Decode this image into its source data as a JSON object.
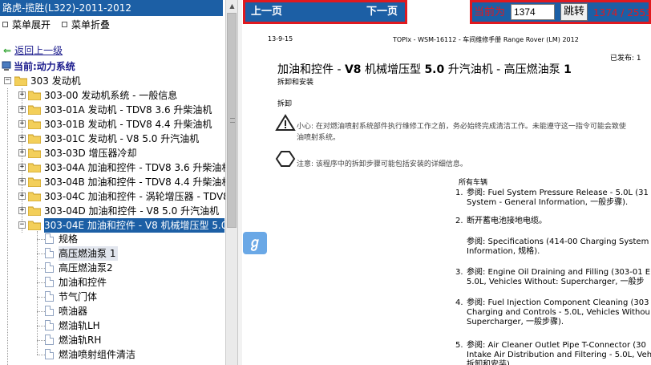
{
  "left_panel": {
    "title": "路虎-揽胜(L322)-2011-2012",
    "menu_expand": "菜单展开",
    "menu_collapse": "菜单折叠",
    "back_link": "返回上一级",
    "current": "当前:动力系统",
    "root_node": "303 发动机",
    "tree": [
      "303-00 发动机系统 - 一般信息",
      "303-01A 发动机 - TDV8 3.6 升柴油机",
      "303-01B 发动机 - TDV8 4.4 升柴油机",
      "303-01C 发动机 - V8 5.0 升汽油机",
      "303-03D 增压器冷却",
      "303-04A 加油和控件 - TDV8 3.6 升柴油机",
      "303-04B 加油和控件 - TDV8 4.4 升柴油机",
      "303-04C 加油和控件 - 涡轮增压器 - TDV8",
      "303-04D 加油和控件 - V8 5.0 升汽油机",
      "303-04E 加油和控件 - V8 机械增压型 5.0"
    ],
    "leaves": [
      "规格",
      "高压燃油泵 1",
      "高压燃油泵2",
      "加油和控件",
      "节气门体",
      "喷油器",
      "燃油轨LH",
      "燃油轨RH",
      "燃油喷射组件清洁"
    ]
  },
  "toggle_icon": "panel-toggle-icon",
  "nav": {
    "prev": "上一页",
    "next": "下一页",
    "page_label": "当前为",
    "page_value": "1374",
    "jump": "跳转",
    "page_total": "1374 / 2553"
  },
  "doc": {
    "date": "13-9-15",
    "header": "TOPIx - WSM-16112 - 车间维修手册 Range Rover (LM) 2012",
    "released": "已发布: 1",
    "title_pre": "加油和控件 - ",
    "title_bold1": "V8",
    "title_mid": " 机械增压型 ",
    "title_bold2": "5.0",
    "title_post": " 升汽油机 - 高压燃油泵 ",
    "title_bold3": "1",
    "subtitle": "拆卸和安装",
    "section": "拆卸",
    "caution": "小心: 在对燃油喷射系统部件执行维修工作之前，务必始终完成清洁工作。未能遵守这一指令可能会致使",
    "caution2": "油喷射系统。",
    "note": "注意: 该程序中的拆卸步骤可能包括安装的详细信息。",
    "all_vehicles": "所有车辆",
    "steps": [
      {
        "num": "1.",
        "l1": "参阅: Fuel System Pressure Release - 5.0L (31",
        "l2": "System - General Information, 一般步骤)."
      },
      {
        "num": "2.",
        "l1": "断开蓄电池接地电缆。",
        "l2": ""
      },
      {
        "num": "",
        "l1": "参阅: Specifications (414-00 Charging System",
        "l2": "Information, 规格)."
      },
      {
        "num": "3.",
        "l1": "参阅: Engine Oil Draining and Filling (303-01 E",
        "l2": "5.0L, Vehicles Without: Supercharger, 一般步"
      },
      {
        "num": "4.",
        "l1": "参阅: Fuel Injection Component Cleaning (303",
        "l2": "Charging and Controls - 5.0L, Vehicles Withou",
        "l3": "Supercharger, 一般步骤)."
      },
      {
        "num": "5.",
        "l1": "参阅: Air Cleaner Outlet Pipe T-Connector (30",
        "l2": "Intake Air Distribution and Filtering - 5.0L, Vehic",
        "l3": "拆卸和安装)."
      }
    ]
  },
  "colors": {
    "header_blue": "#1c5fa5",
    "accent_red": "#e0191f",
    "link_blue": "#1a1a8c"
  }
}
